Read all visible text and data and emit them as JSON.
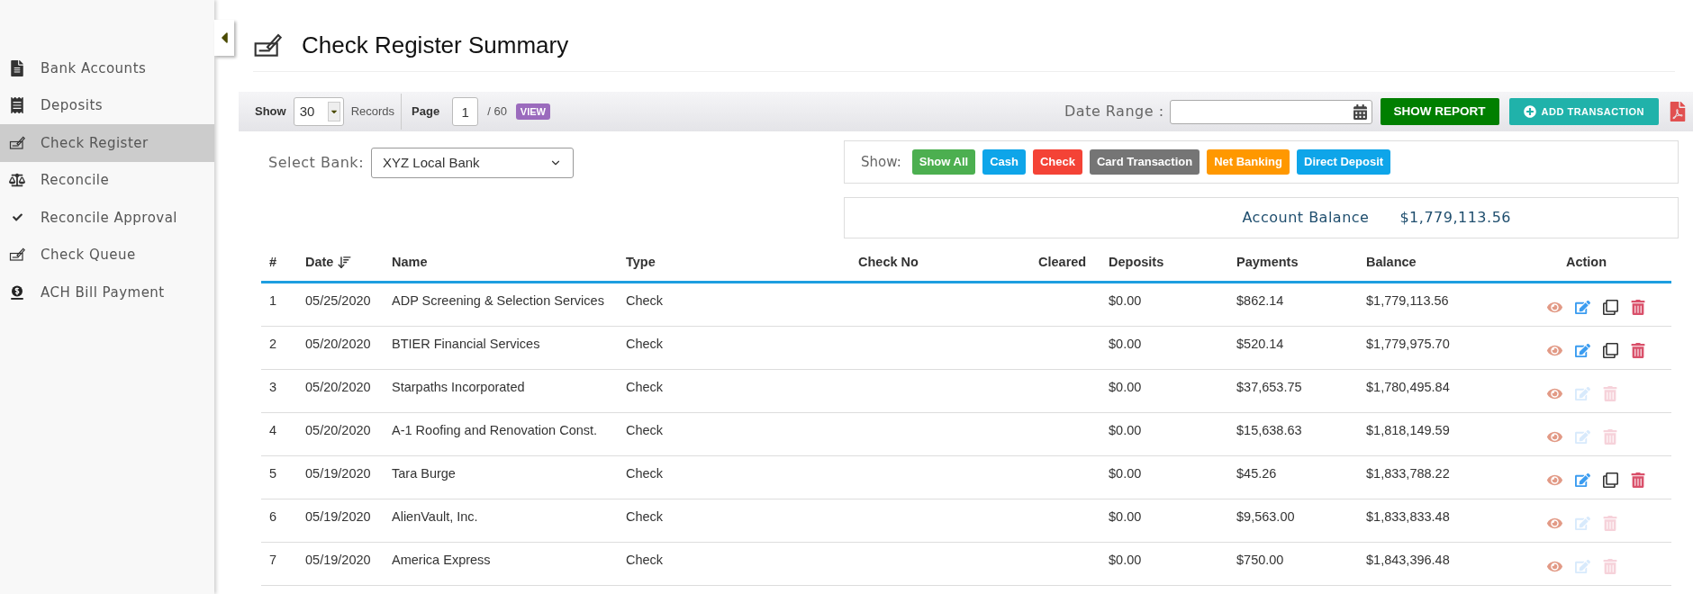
{
  "sidebar": {
    "items": [
      {
        "label": "Bank Accounts",
        "selected": false
      },
      {
        "label": "Deposits",
        "selected": false
      },
      {
        "label": "Check Register",
        "selected": true
      },
      {
        "label": "Reconcile",
        "selected": false
      },
      {
        "label": "Reconcile Approval",
        "selected": false
      },
      {
        "label": "Check Queue",
        "selected": false
      },
      {
        "label": "ACH Bill Payment",
        "selected": false
      }
    ]
  },
  "page_title": "Check Register Summary",
  "toolbar": {
    "show_label": "Show",
    "records_value": "30",
    "records_label": "Records",
    "page_label": "Page",
    "page_value": "1",
    "page_total": "/ 60",
    "view_button": "VIEW",
    "date_range_label": "Date Range :",
    "show_report_button": "SHOW REPORT",
    "add_transaction_button": "ADD TRANSACTION"
  },
  "select_bank": {
    "label": "Select Bank:",
    "value": "XYZ Local Bank"
  },
  "filters": {
    "label": "Show:",
    "chips": [
      {
        "label": "Show All",
        "color": "#4caf50"
      },
      {
        "label": "Cash",
        "color": "#0ea5e9"
      },
      {
        "label": "Check",
        "color": "#f44336"
      },
      {
        "label": "Card Transaction",
        "color": "#757575"
      },
      {
        "label": "Net Banking",
        "color": "#ff9800"
      },
      {
        "label": "Direct Deposit",
        "color": "#0ea5e9"
      }
    ]
  },
  "account_balance": {
    "label": "Account Balance",
    "value": "$1,779,113.56"
  },
  "table": {
    "columns": [
      "#",
      "Date",
      "Name",
      "Type",
      "Check No",
      "Cleared",
      "Deposits",
      "Payments",
      "Balance",
      "Action"
    ],
    "rows": [
      {
        "num": "1",
        "date": "05/25/2020",
        "name": "ADP Screening & Selection Services",
        "type": "Check",
        "deposits": "$0.00",
        "payments": "$862.14",
        "balance": "$1,779,113.56",
        "editable": true
      },
      {
        "num": "2",
        "date": "05/20/2020",
        "name": "BTIER Financial Services",
        "type": "Check",
        "deposits": "$0.00",
        "payments": "$520.14",
        "balance": "$1,779,975.70",
        "editable": true
      },
      {
        "num": "3",
        "date": "05/20/2020",
        "name": "Starpaths Incorporated",
        "type": "Check",
        "deposits": "$0.00",
        "payments": "$37,653.75",
        "balance": "$1,780,495.84",
        "editable": false
      },
      {
        "num": "4",
        "date": "05/20/2020",
        "name": "A-1 Roofing and Renovation Const.",
        "type": "Check",
        "deposits": "$0.00",
        "payments": "$15,638.63",
        "balance": "$1,818,149.59",
        "editable": false
      },
      {
        "num": "5",
        "date": "05/19/2020",
        "name": "Tara Burge",
        "type": "Check",
        "deposits": "$0.00",
        "payments": "$45.26",
        "balance": "$1,833,788.22",
        "editable": true
      },
      {
        "num": "6",
        "date": "05/19/2020",
        "name": "AlienVault, Inc.",
        "type": "Check",
        "deposits": "$0.00",
        "payments": "$9,563.00",
        "balance": "$1,833,833.48",
        "editable": false
      },
      {
        "num": "7",
        "date": "05/19/2020",
        "name": "America Express",
        "type": "Check",
        "deposits": "$0.00",
        "payments": "$750.00",
        "balance": "$1,843,396.48",
        "editable": false
      }
    ]
  }
}
